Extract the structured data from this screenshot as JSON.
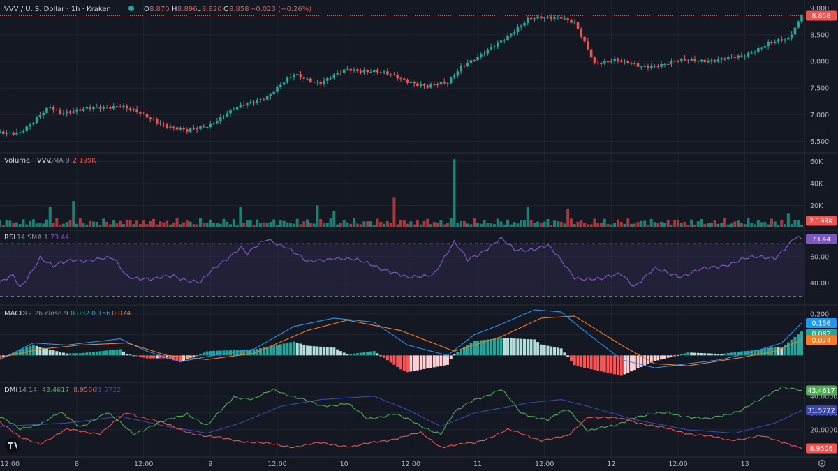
{
  "header": {
    "symbol_title": "VVV / U. S. Dollar · 1h · Kraken",
    "ohlc": {
      "o_label": "O",
      "o": "8.870",
      "h_label": "H",
      "h": "8.896",
      "l_label": "L",
      "l": "8.820",
      "c_label": "C",
      "c": "8.858",
      "change": "−0.023 (−0.26%)"
    }
  },
  "colors": {
    "background": "#141823",
    "grid": "#1f2431",
    "up": "#26a69a",
    "down": "#ef5350",
    "rsi": "#7e57c2",
    "macd": "#2196f3",
    "signal": "#ff7a1a",
    "dmi_plus": "#4caf50",
    "dmi_minus": "#ef5350",
    "adx": "#3949ab"
  },
  "chart_data": {
    "type": "candlestick",
    "x_ticks": [
      "12:00",
      "8",
      "12:00",
      "9",
      "12:00",
      "10",
      "12:00",
      "11",
      "12:00",
      "12",
      "12:00",
      "13"
    ],
    "price": {
      "y_ticks": [
        "9.000",
        "8.500",
        "8.000",
        "7.500",
        "7.000",
        "6.500"
      ],
      "ylim": [
        6.35,
        9.1
      ],
      "last_price": "8.858",
      "anchors": [
        [
          0,
          6.66
        ],
        [
          6,
          6.68
        ],
        [
          10,
          6.85
        ],
        [
          15,
          7.15
        ],
        [
          18,
          7.05
        ],
        [
          26,
          7.1
        ],
        [
          36,
          7.18
        ],
        [
          44,
          6.95
        ],
        [
          50,
          6.8
        ],
        [
          56,
          6.68
        ],
        [
          62,
          6.8
        ],
        [
          70,
          7.1
        ],
        [
          80,
          7.35
        ],
        [
          88,
          7.75
        ],
        [
          96,
          7.6
        ],
        [
          104,
          7.85
        ],
        [
          112,
          7.82
        ],
        [
          118,
          7.72
        ],
        [
          128,
          7.52
        ],
        [
          134,
          7.6
        ],
        [
          138,
          7.92
        ],
        [
          144,
          8.1
        ],
        [
          158,
          8.78
        ],
        [
          168,
          8.85
        ],
        [
          172,
          8.72
        ],
        [
          178,
          7.95
        ],
        [
          184,
          8.05
        ],
        [
          192,
          7.88
        ],
        [
          202,
          8.0
        ],
        [
          214,
          8.03
        ],
        [
          222,
          8.08
        ],
        [
          230,
          8.35
        ],
        [
          236,
          8.4
        ],
        [
          240,
          8.858
        ]
      ]
    },
    "volume": {
      "title": "Volume · VVV",
      "sma_label": "SMA 9",
      "value": "2.199K",
      "y_ticks": [
        "60K",
        "40K",
        "20K"
      ],
      "ylim": [
        0,
        64000
      ],
      "spikes": [
        [
          22,
          24000
        ],
        [
          136,
          62000
        ],
        [
          95,
          20000
        ],
        [
          118,
          27000
        ],
        [
          15,
          19000
        ],
        [
          72,
          19000
        ],
        [
          100,
          15000
        ],
        [
          158,
          19000
        ],
        [
          170,
          17000
        ],
        [
          236,
          13000
        ]
      ]
    },
    "rsi": {
      "title": "RSI",
      "params": "14 SMA 1",
      "value": "73.44",
      "y_ticks": [
        "60.00",
        "40.00"
      ],
      "ylim": [
        25,
        78
      ],
      "upper_band": 70,
      "lower_band": 30,
      "anchors": [
        [
          0,
          40
        ],
        [
          4,
          45
        ],
        [
          6,
          36
        ],
        [
          12,
          60
        ],
        [
          16,
          52
        ],
        [
          22,
          58
        ],
        [
          34,
          58
        ],
        [
          38,
          46
        ],
        [
          46,
          42
        ],
        [
          52,
          46
        ],
        [
          60,
          40
        ],
        [
          66,
          55
        ],
        [
          72,
          68
        ],
        [
          74,
          62
        ],
        [
          80,
          73
        ],
        [
          86,
          68
        ],
        [
          92,
          55
        ],
        [
          100,
          60
        ],
        [
          112,
          54
        ],
        [
          116,
          50
        ],
        [
          122,
          43
        ],
        [
          130,
          48
        ],
        [
          136,
          70
        ],
        [
          140,
          58
        ],
        [
          150,
          73
        ],
        [
          154,
          65
        ],
        [
          164,
          68
        ],
        [
          172,
          45
        ],
        [
          180,
          42
        ],
        [
          186,
          48
        ],
        [
          190,
          38
        ],
        [
          196,
          50
        ],
        [
          204,
          46
        ],
        [
          214,
          52
        ],
        [
          222,
          58
        ],
        [
          232,
          60
        ],
        [
          238,
          74
        ],
        [
          240,
          73.44
        ]
      ]
    },
    "macd": {
      "title": "MACD",
      "params": "12 26 close 9",
      "values": [
        "0.082",
        "0.156",
        "0.074"
      ],
      "y_ticks": [
        "0.200",
        "0.100"
      ],
      "ylim": [
        -0.12,
        0.23
      ],
      "anchors_macd": [
        [
          0,
          -0.02
        ],
        [
          10,
          0.06
        ],
        [
          20,
          0.05
        ],
        [
          36,
          0.08
        ],
        [
          44,
          0.02
        ],
        [
          54,
          -0.03
        ],
        [
          64,
          0.0
        ],
        [
          76,
          0.03
        ],
        [
          88,
          0.14
        ],
        [
          100,
          0.18
        ],
        [
          112,
          0.16
        ],
        [
          122,
          0.05
        ],
        [
          134,
          0.0
        ],
        [
          142,
          0.1
        ],
        [
          150,
          0.15
        ],
        [
          160,
          0.22
        ],
        [
          168,
          0.21
        ],
        [
          174,
          0.13
        ],
        [
          186,
          -0.02
        ],
        [
          196,
          -0.06
        ],
        [
          206,
          -0.04
        ],
        [
          216,
          -0.02
        ],
        [
          226,
          0.02
        ],
        [
          234,
          0.06
        ],
        [
          240,
          0.156
        ]
      ],
      "anchors_signal": [
        [
          0,
          -0.01
        ],
        [
          12,
          0.03
        ],
        [
          24,
          0.05
        ],
        [
          38,
          0.06
        ],
        [
          50,
          0.0
        ],
        [
          62,
          -0.02
        ],
        [
          76,
          0.01
        ],
        [
          92,
          0.12
        ],
        [
          104,
          0.17
        ],
        [
          120,
          0.12
        ],
        [
          136,
          0.02
        ],
        [
          150,
          0.09
        ],
        [
          162,
          0.18
        ],
        [
          172,
          0.19
        ],
        [
          186,
          0.05
        ],
        [
          196,
          -0.04
        ],
        [
          206,
          -0.05
        ],
        [
          222,
          -0.01
        ],
        [
          232,
          0.02
        ],
        [
          240,
          0.074
        ]
      ]
    },
    "dmi": {
      "title": "DMI",
      "params": "14 14",
      "values": [
        "43.4617",
        "8.9506",
        "31.5722"
      ],
      "y_ticks": [
        "40.0000",
        "30.0000",
        "20.0000"
      ],
      "ylim": [
        5,
        47
      ],
      "anchors_plus": [
        [
          0,
          28
        ],
        [
          6,
          20
        ],
        [
          12,
          24
        ],
        [
          18,
          30
        ],
        [
          24,
          22
        ],
        [
          32,
          30
        ],
        [
          40,
          18
        ],
        [
          48,
          24
        ],
        [
          56,
          30
        ],
        [
          62,
          22
        ],
        [
          70,
          40
        ],
        [
          76,
          38
        ],
        [
          82,
          44
        ],
        [
          88,
          40
        ],
        [
          96,
          34
        ],
        [
          104,
          36
        ],
        [
          110,
          26
        ],
        [
          118,
          30
        ],
        [
          126,
          22
        ],
        [
          132,
          18
        ],
        [
          136,
          30
        ],
        [
          142,
          38
        ],
        [
          150,
          44
        ],
        [
          156,
          30
        ],
        [
          164,
          26
        ],
        [
          170,
          32
        ],
        [
          176,
          20
        ],
        [
          184,
          22
        ],
        [
          190,
          28
        ],
        [
          200,
          30
        ],
        [
          212,
          26
        ],
        [
          222,
          32
        ],
        [
          228,
          38
        ],
        [
          234,
          46
        ],
        [
          240,
          43.4617
        ]
      ],
      "anchors_minus": [
        [
          0,
          25
        ],
        [
          6,
          15
        ],
        [
          12,
          12
        ],
        [
          20,
          20
        ],
        [
          30,
          18
        ],
        [
          38,
          30
        ],
        [
          46,
          26
        ],
        [
          54,
          20
        ],
        [
          62,
          16
        ],
        [
          70,
          14
        ],
        [
          78,
          12
        ],
        [
          88,
          10
        ],
        [
          96,
          12
        ],
        [
          106,
          10
        ],
        [
          116,
          14
        ],
        [
          126,
          18
        ],
        [
          132,
          10
        ],
        [
          142,
          12
        ],
        [
          152,
          20
        ],
        [
          162,
          14
        ],
        [
          170,
          16
        ],
        [
          176,
          28
        ],
        [
          188,
          26
        ],
        [
          196,
          22
        ],
        [
          206,
          18
        ],
        [
          218,
          14
        ],
        [
          228,
          16
        ],
        [
          236,
          12
        ],
        [
          240,
          8.9506
        ]
      ],
      "anchors_adx": [
        [
          0,
          22
        ],
        [
          20,
          24
        ],
        [
          36,
          28
        ],
        [
          50,
          22
        ],
        [
          62,
          18
        ],
        [
          72,
          24
        ],
        [
          84,
          34
        ],
        [
          96,
          38
        ],
        [
          112,
          40
        ],
        [
          122,
          32
        ],
        [
          132,
          22
        ],
        [
          142,
          30
        ],
        [
          158,
          36
        ],
        [
          168,
          38
        ],
        [
          176,
          34
        ],
        [
          190,
          26
        ],
        [
          206,
          20
        ],
        [
          220,
          18
        ],
        [
          232,
          24
        ],
        [
          240,
          31.5722
        ]
      ]
    }
  }
}
